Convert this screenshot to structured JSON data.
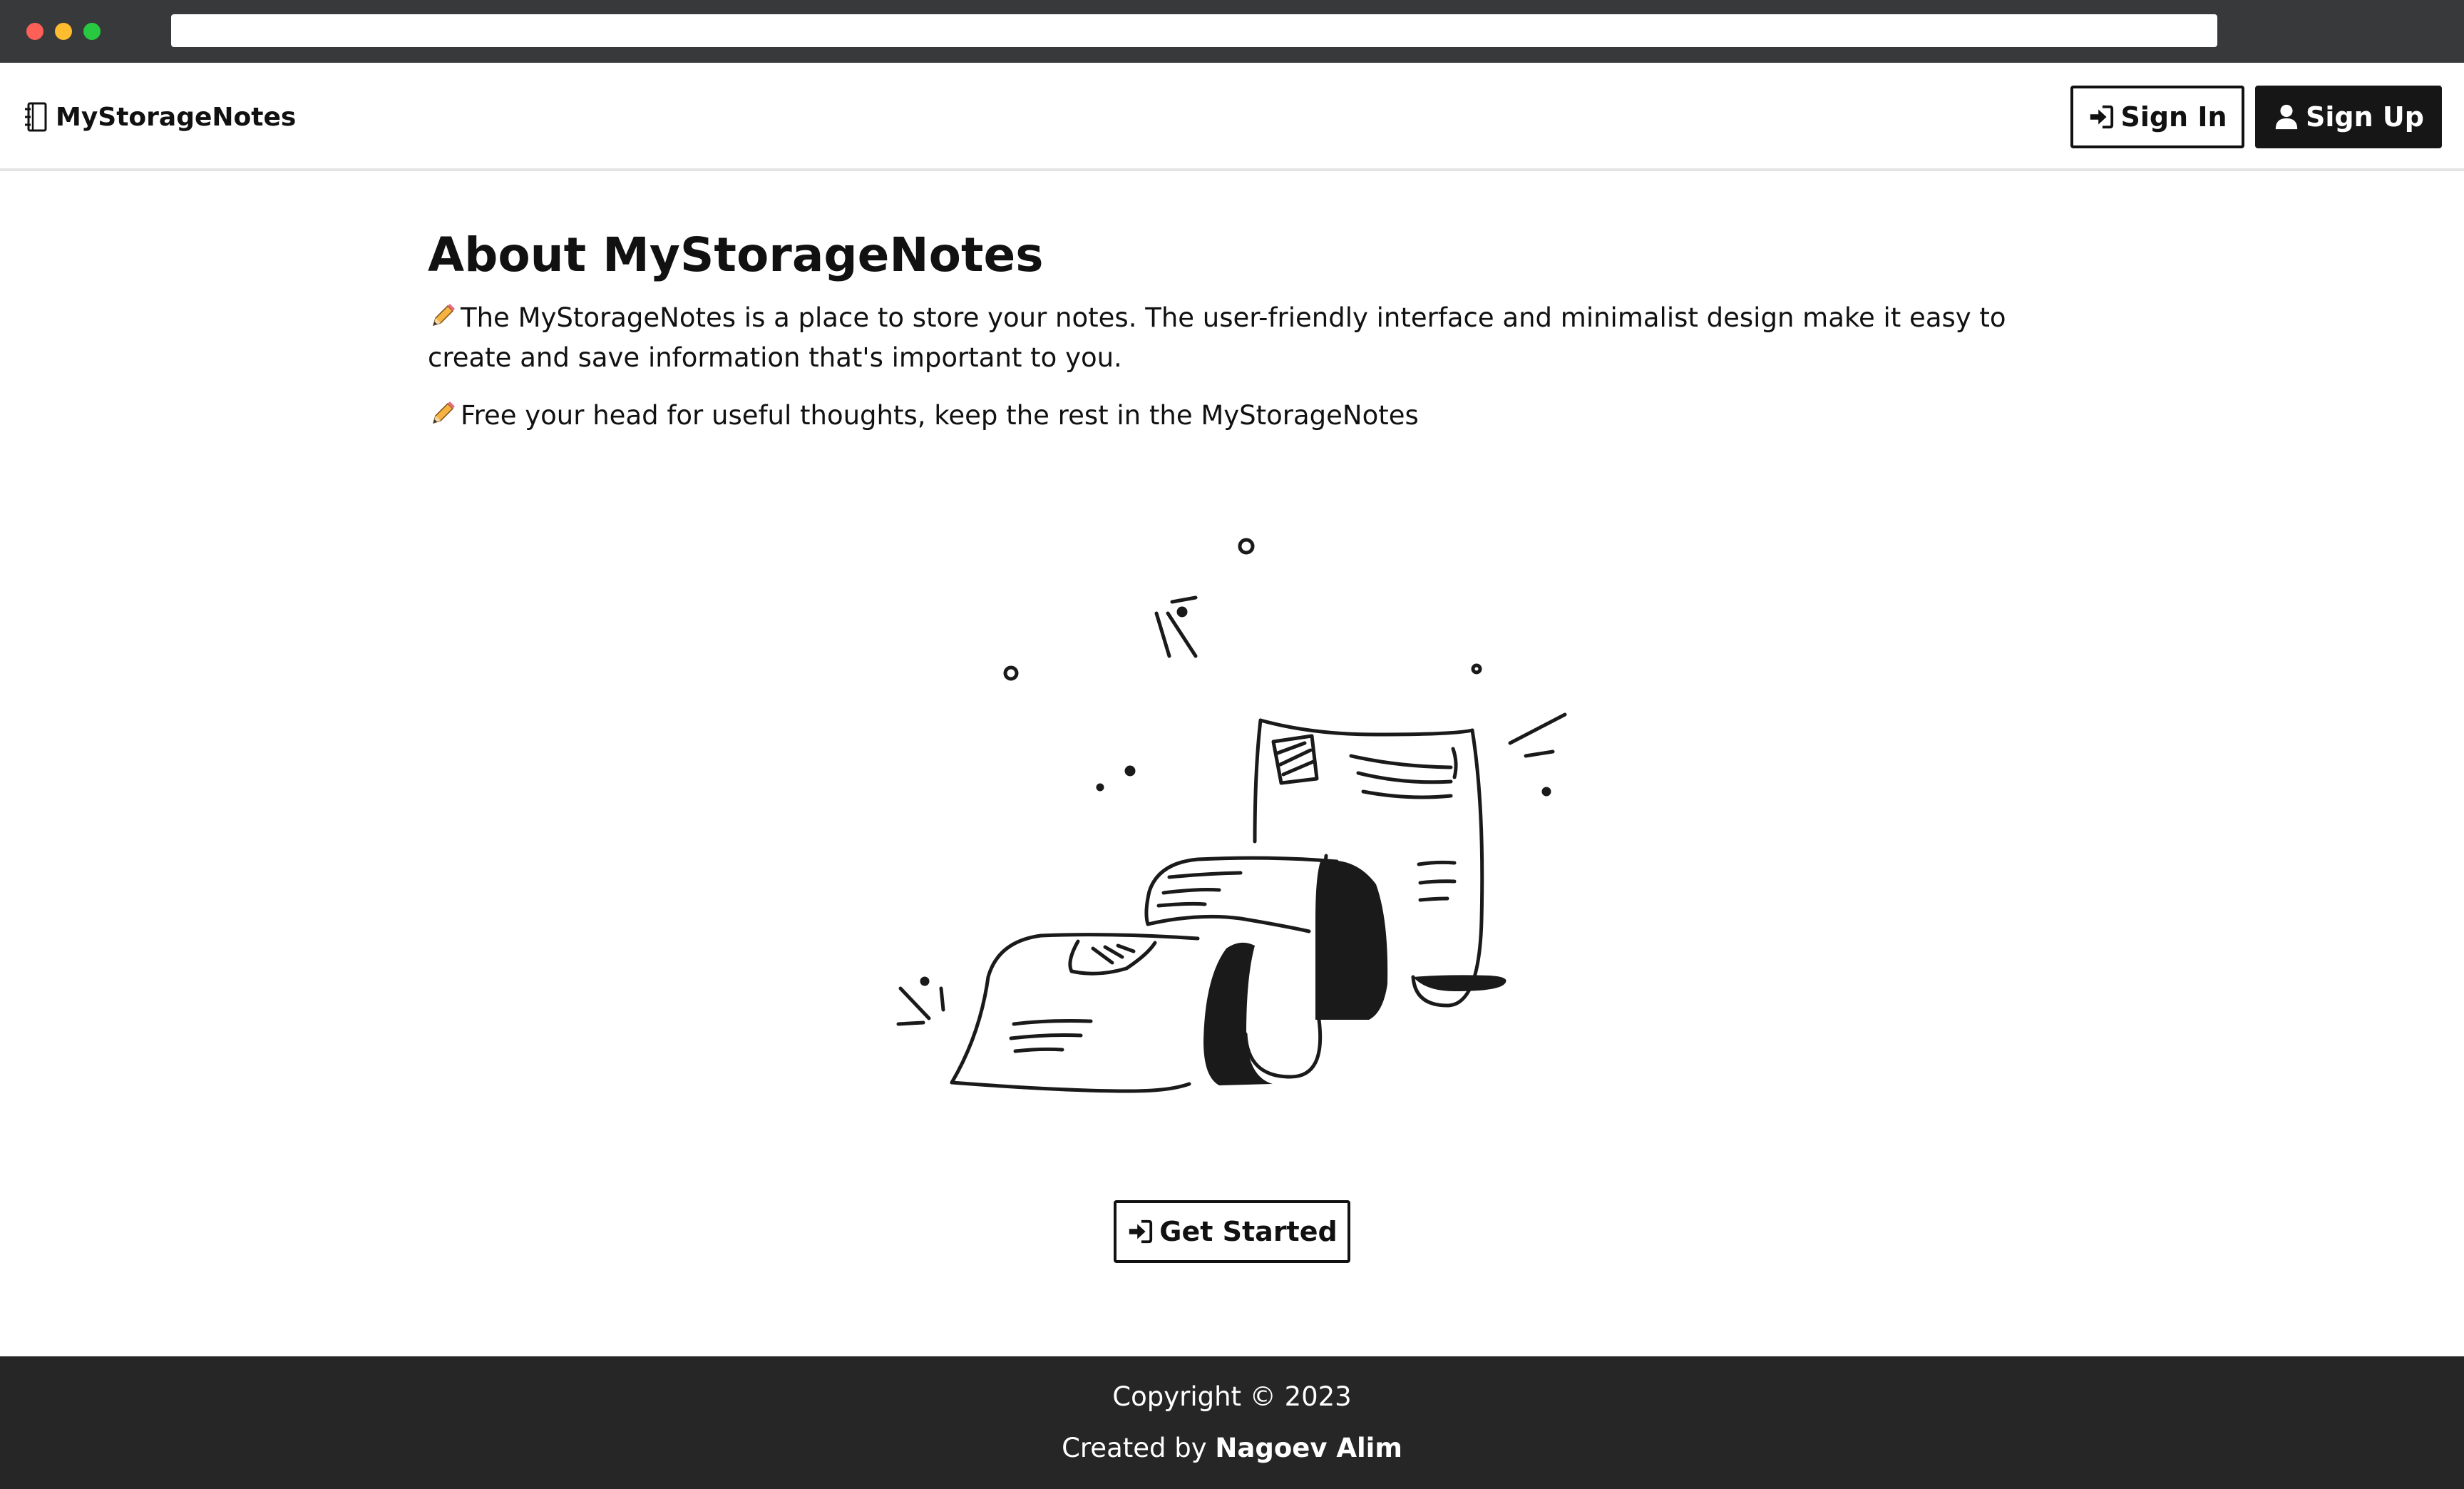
{
  "navbar": {
    "brand": "MyStorageNotes",
    "signin_label": "Sign In",
    "signup_label": "Sign Up"
  },
  "main": {
    "title": "About MyStorageNotes",
    "paragraph1": "The MyStorageNotes is a place to store your notes. The user-friendly interface and minimalist design make it easy to create and save information that's important to you.",
    "paragraph2": "Free your head for useful thoughts, keep the rest in the MyStorageNotes",
    "get_started_label": "Get Started"
  },
  "footer": {
    "copyright": "Copyright © 2023",
    "created_prefix": "Created by",
    "author": "Nagoev Alim"
  },
  "icons": {
    "brand": "notebook-icon",
    "signin": "sign-in-icon",
    "signup": "user-icon",
    "pencil": "pencil-icon",
    "get_started": "sign-in-icon"
  },
  "colors": {
    "footer_bg": "#262626",
    "signup_bg": "#161616",
    "chrome_bg": "#38393b"
  }
}
